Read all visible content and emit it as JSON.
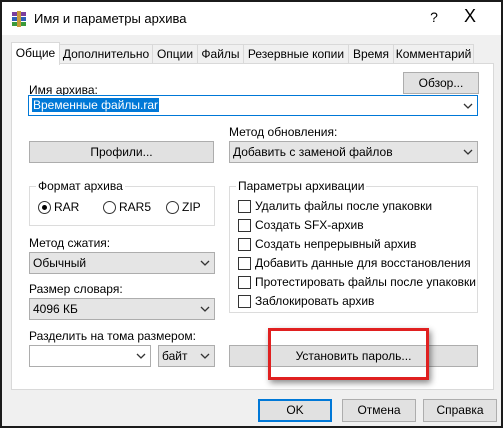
{
  "window": {
    "title": "Имя и параметры архива",
    "help_glyph": "?",
    "close_glyph": "X"
  },
  "tabs": [
    {
      "label": "Общие",
      "active": true
    },
    {
      "label": "Дополнительно"
    },
    {
      "label": "Опции"
    },
    {
      "label": "Файлы"
    },
    {
      "label": "Резервные копии"
    },
    {
      "label": "Время"
    },
    {
      "label": "Комментарий"
    }
  ],
  "general": {
    "archive_name_label": "Имя архива:",
    "browse_button": "Обзор...",
    "archive_name_value": "Временные файлы.rar",
    "update_method_label": "Метод обновления:",
    "update_method_value": "Добавить с заменой файлов",
    "profiles_button": "Профили...",
    "format_group_label": "Формат архива",
    "formats": [
      {
        "label": "RAR",
        "selected": true
      },
      {
        "label": "RAR5",
        "selected": false
      },
      {
        "label": "ZIP",
        "selected": false
      }
    ],
    "compression_label": "Метод сжатия:",
    "compression_value": "Обычный",
    "dictionary_label": "Размер словаря:",
    "dictionary_value": "4096 КБ",
    "split_label": "Разделить на тома размером:",
    "split_value": "",
    "split_unit": "байт",
    "set_password_button": "Установить пароль...",
    "options_group_label": "Параметры архивации",
    "options": [
      {
        "label": "Удалить файлы после упаковки",
        "checked": false
      },
      {
        "label": "Создать SFX-архив",
        "checked": false
      },
      {
        "label": "Создать непрерывный архив",
        "checked": false
      },
      {
        "label": "Добавить данные для восстановления",
        "checked": false
      },
      {
        "label": "Протестировать файлы после упаковки",
        "checked": false
      },
      {
        "label": "Заблокировать архив",
        "checked": false
      }
    ]
  },
  "footer": {
    "ok": "OK",
    "cancel": "Отмена",
    "help": "Справка"
  },
  "colors": {
    "accent": "#0078d7",
    "highlight": "#e02020"
  }
}
